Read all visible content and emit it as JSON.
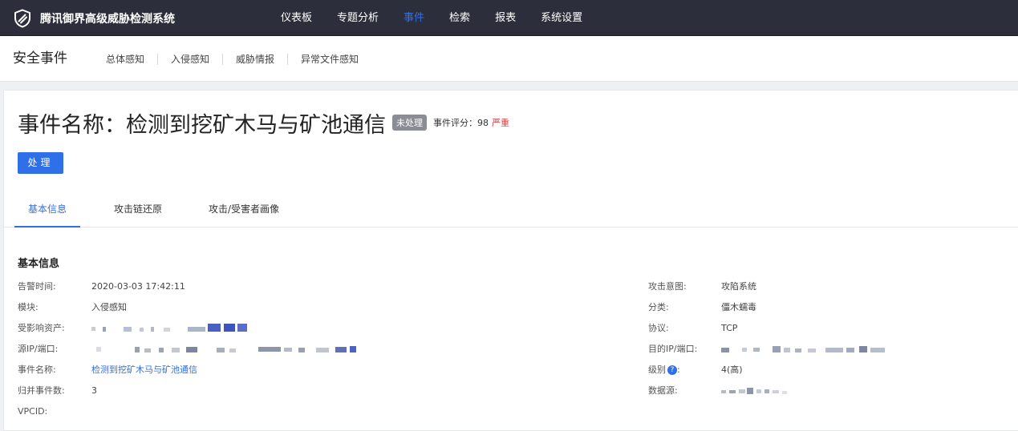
{
  "topbar": {
    "app_title": "腾讯御界高级威胁检测系统",
    "nav": [
      {
        "label": "仪表板",
        "active": false
      },
      {
        "label": "专题分析",
        "active": false
      },
      {
        "label": "事件",
        "active": true
      },
      {
        "label": "检索",
        "active": false
      },
      {
        "label": "报表",
        "active": false
      },
      {
        "label": "系统设置",
        "active": false
      }
    ]
  },
  "subbar": {
    "title": "安全事件",
    "nav": [
      "总体感知",
      "入侵感知",
      "威胁情报",
      "异常文件感知"
    ]
  },
  "event": {
    "name_label": "事件名称：",
    "name": "检测到挖矿木马与矿池通信",
    "status_badge": "未处理",
    "score_label": "事件评分：",
    "score": "98",
    "severity": "严重",
    "handle_button": "处理"
  },
  "tabs": [
    "基本信息",
    "攻击链还原",
    "攻击/受害者画像"
  ],
  "basic_info": {
    "section_title": "基本信息",
    "left": [
      {
        "label": "告警时间:",
        "value": "2020-03-03 17:42:11"
      },
      {
        "label": "模块:",
        "value": "入侵感知"
      },
      {
        "label": "受影响资产:",
        "value": ""
      },
      {
        "label": "源IP/端口:",
        "value": ""
      },
      {
        "label": "事件名称:",
        "value": "检测到挖矿木马与矿池通信"
      },
      {
        "label": "归并事件数:",
        "value": "3"
      },
      {
        "label": "VPCID:",
        "value": ""
      }
    ],
    "right": [
      {
        "label": "攻击意图:",
        "value": "攻陷系统"
      },
      {
        "label": "分类:",
        "value": "僵木蠕毒"
      },
      {
        "label": "协议:",
        "value": "TCP"
      },
      {
        "label": "目的IP/端口:",
        "value": ""
      },
      {
        "label": "级别",
        "value": "4(高)"
      },
      {
        "label": "数据源:",
        "value": ""
      }
    ],
    "level_colon": ":"
  },
  "colors": {
    "accent": "#2f6fe8",
    "severity": "#e03c3c",
    "topbar_bg": "#2c2f3b",
    "badge_bg": "#8a8d94"
  }
}
